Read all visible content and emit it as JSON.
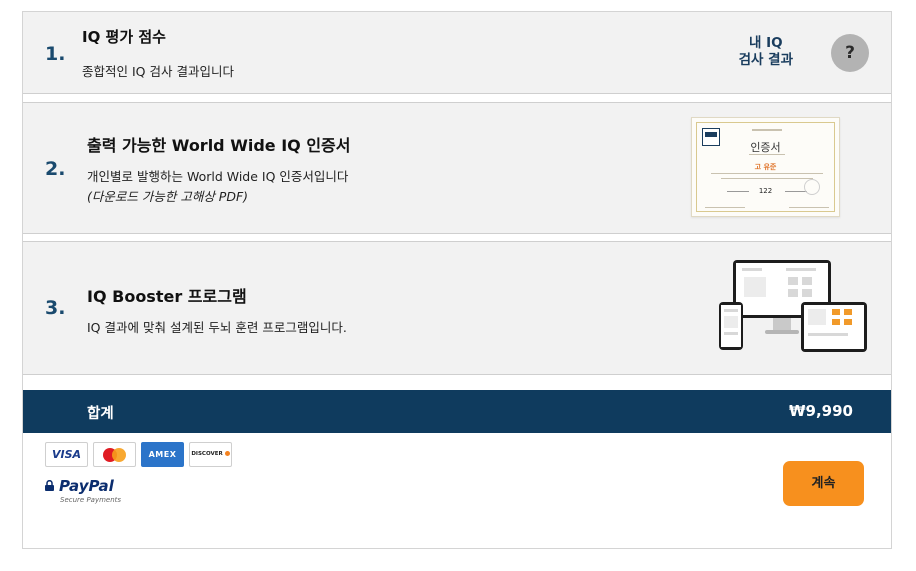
{
  "items": [
    {
      "number": "1.",
      "title": "IQ 평가 점수",
      "description": "종합적인 IQ 검사 결과입니다"
    },
    {
      "number": "2.",
      "title": "출력 가능한 World Wide IQ 인증서",
      "description": "개인별로 발행하는 World Wide IQ 인증서입니다",
      "note": "(다운로드 가능한 고해상 PDF)"
    },
    {
      "number": "3.",
      "title": "IQ Booster 프로그램",
      "description": "IQ 결과에 맞춰 설계된 두뇌 훈련 프로그램입니다."
    }
  ],
  "my_result": {
    "line1": "내 IQ",
    "line2": "검사 결과",
    "help_icon_label": "?"
  },
  "certificate": {
    "heading": "인증서",
    "name": "고 유준",
    "score": "122"
  },
  "total": {
    "label": "합계",
    "amount": "₩9,990"
  },
  "payment": {
    "cards": [
      "VISA",
      "MasterCard",
      "AMEX",
      "DISCOVER"
    ],
    "paypal": "PayPal",
    "paypal_sub": "Secure Payments"
  },
  "continue_button": "계속",
  "colors": {
    "navy": "#0f3b5e",
    "orange": "#f7901e",
    "row_bg": "#f2f2f2"
  }
}
